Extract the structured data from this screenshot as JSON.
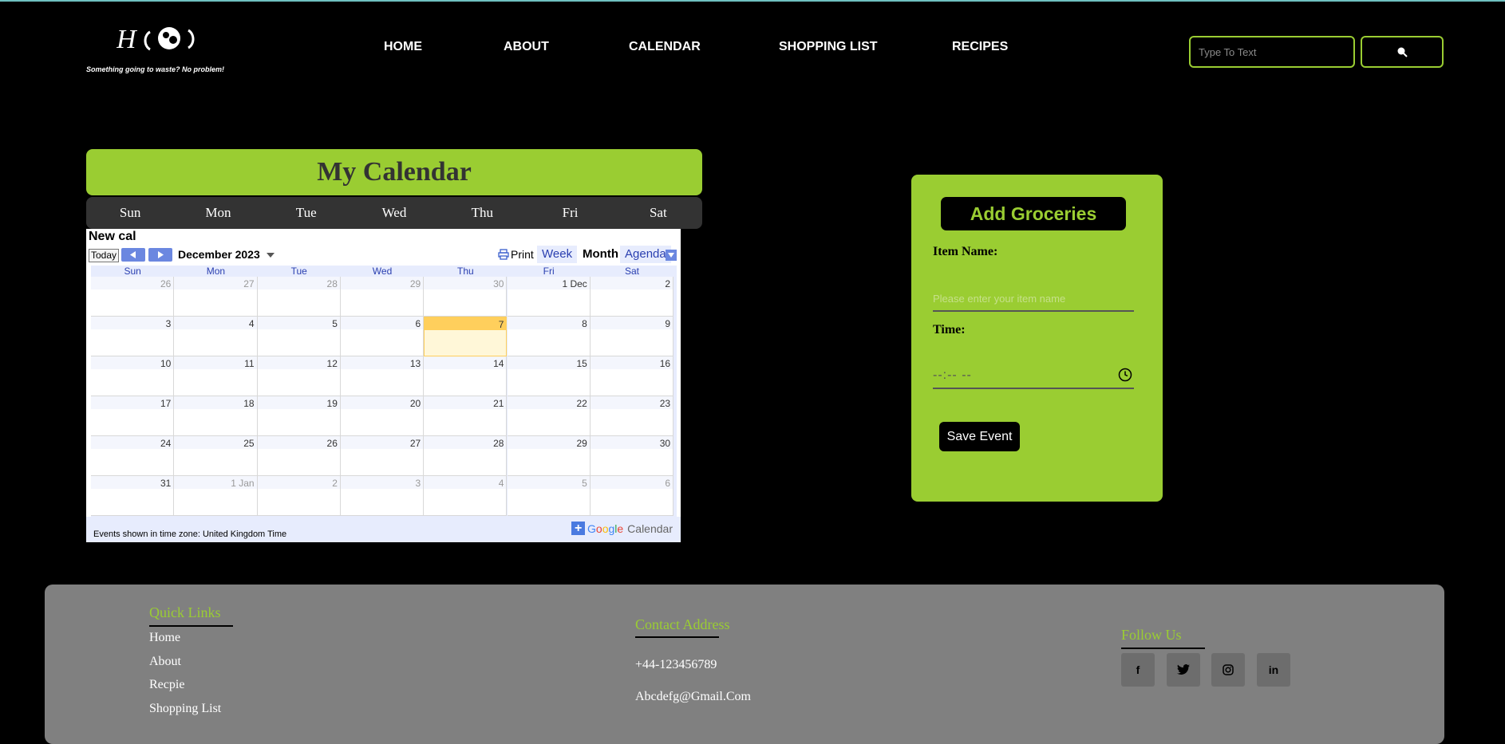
{
  "header": {
    "logo_tagline": "Something going to waste? No problem!",
    "nav": [
      "HOME",
      "ABOUT",
      "CALENDAR",
      "SHOPPING LIST",
      "RECIPES"
    ],
    "search_placeholder": "Type To Text",
    "search_icon": "search-icon"
  },
  "calendar_section": {
    "title": "My Calendar",
    "days": [
      "Sun",
      "Mon",
      "Tue",
      "Wed",
      "Thu",
      "Fri",
      "Sat"
    ]
  },
  "embed": {
    "name": "New cal",
    "today_label": "Today",
    "month_label": "December 2023",
    "print_label": "Print",
    "views": [
      "Week",
      "Month",
      "Agenda"
    ],
    "active_view": "Month",
    "dow": [
      "Sun",
      "Mon",
      "Tue",
      "Wed",
      "Thu",
      "Fri",
      "Sat"
    ],
    "weeks": [
      [
        "26",
        "27",
        "28",
        "29",
        "30",
        "1 Dec",
        "2"
      ],
      [
        "3",
        "4",
        "5",
        "6",
        "7",
        "8",
        "9"
      ],
      [
        "10",
        "11",
        "12",
        "13",
        "14",
        "15",
        "16"
      ],
      [
        "17",
        "18",
        "19",
        "20",
        "21",
        "22",
        "23"
      ],
      [
        "24",
        "25",
        "26",
        "27",
        "28",
        "29",
        "30"
      ],
      [
        "31",
        "1 Jan",
        "2",
        "3",
        "4",
        "5",
        "6"
      ]
    ],
    "today": "7",
    "timezone_note": "Events shown in time zone: United Kingdom Time",
    "badge_text": "Calendar"
  },
  "grocery": {
    "title": "Add Groceries",
    "item_label": "Item Name:",
    "item_placeholder": "Please enter your item name",
    "time_label": "Time:",
    "time_value": "--:-- --",
    "save_label": "Save Event",
    "accent": "#9acd32"
  },
  "footer": {
    "quick_links_title": "Quick Links",
    "quick_links": [
      "Home",
      "About",
      "Recpie",
      "Shopping List"
    ],
    "contact_title": "Contact Address",
    "phone": "+44-123456789",
    "email": "Abcdefg@Gmail.Com",
    "follow_title": "Follow Us",
    "social": [
      "facebook-icon",
      "twitter-icon",
      "instagram-icon",
      "linkedin-icon"
    ]
  }
}
